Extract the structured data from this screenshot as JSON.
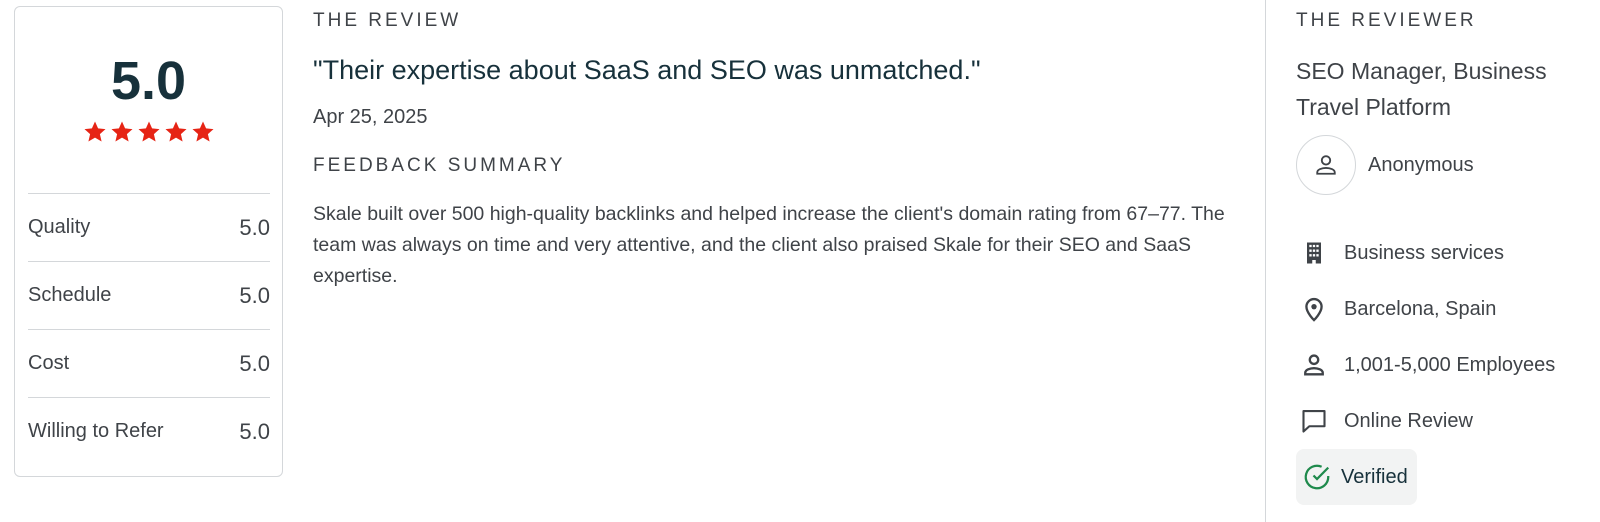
{
  "score_card": {
    "overall_score": "5.0",
    "star_rating": 5,
    "star_color": "#e62415",
    "metrics": [
      {
        "label": "Quality",
        "value": "5.0"
      },
      {
        "label": "Schedule",
        "value": "5.0"
      },
      {
        "label": "Cost",
        "value": "5.0"
      },
      {
        "label": "Willing to Refer",
        "value": "5.0"
      }
    ]
  },
  "review": {
    "section_label": "THE REVIEW",
    "quote": "\"Their expertise about SaaS and SEO was unmatched.\"",
    "date": "Apr 25, 2025",
    "summary_label": "FEEDBACK SUMMARY",
    "summary": "Skale built over 500 high-quality backlinks and helped increase the client's domain rating from 67–77. The team was always on time and very attentive, and the client also praised Skale for their SEO and SaaS expertise."
  },
  "reviewer": {
    "section_label": "THE REVIEWER",
    "title": "SEO Manager, Business Travel Platform",
    "name": "Anonymous",
    "details": [
      {
        "icon": "building-icon",
        "text": "Business services"
      },
      {
        "icon": "location-pin-icon",
        "text": "Barcelona, Spain"
      },
      {
        "icon": "person-icon",
        "text": "1,001-5,000 Employees"
      },
      {
        "icon": "chat-bubble-icon",
        "text": "Online Review"
      }
    ],
    "verified_label": "Verified",
    "verified_color": "#1f8a4c"
  }
}
